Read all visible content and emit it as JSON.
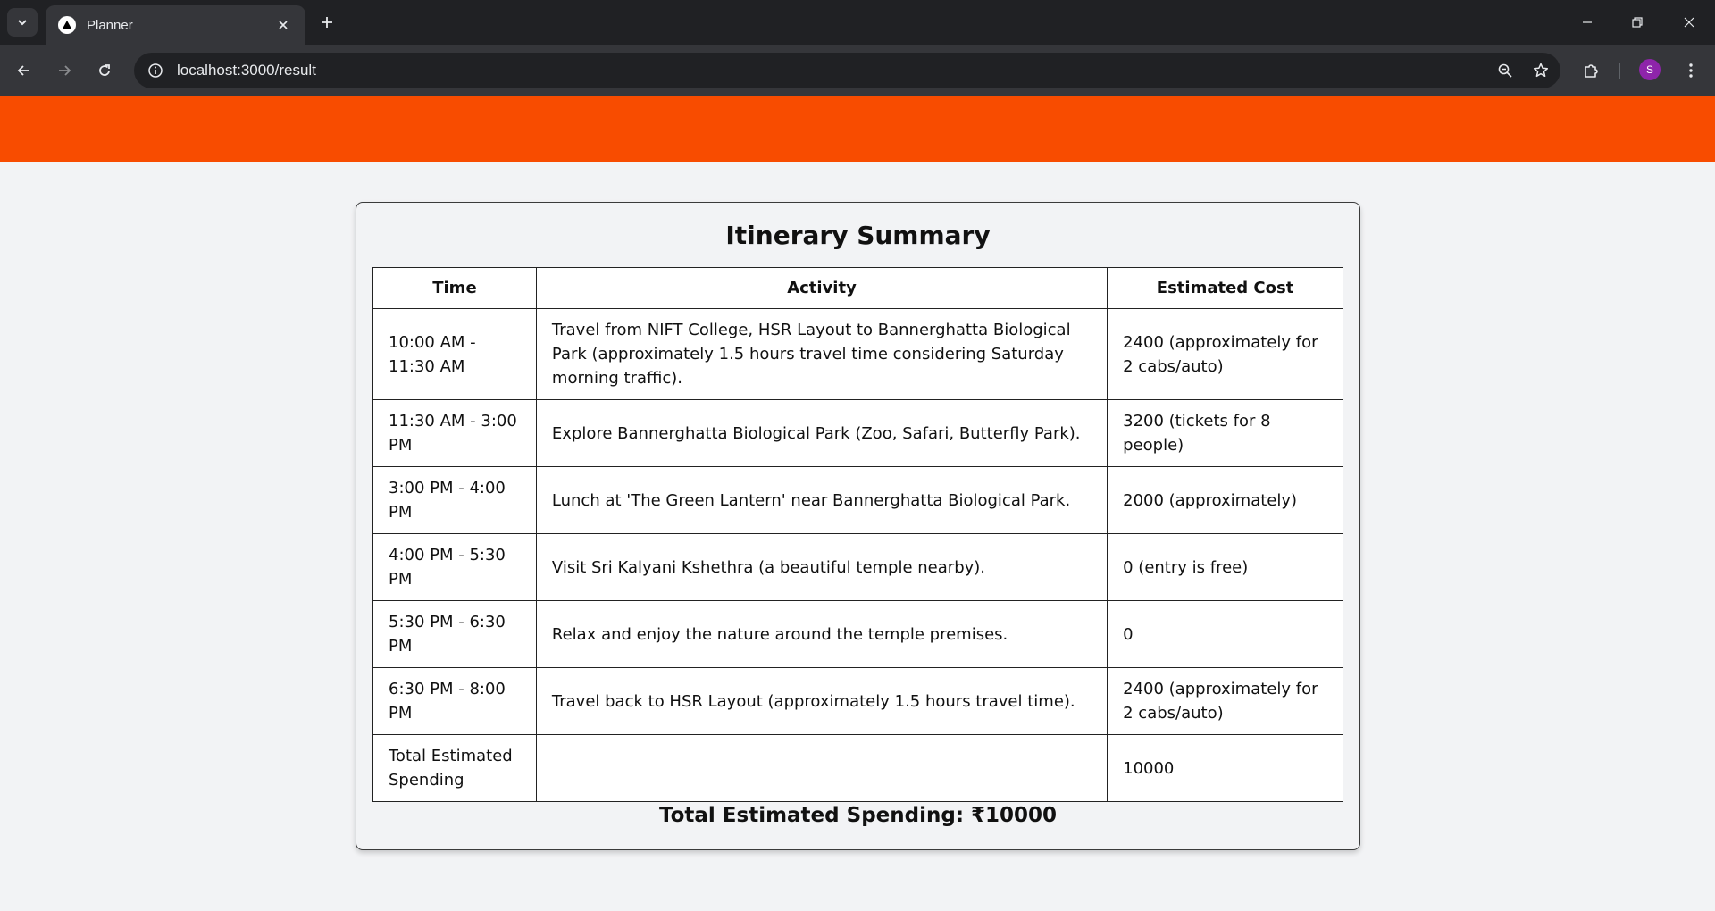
{
  "browser": {
    "tab_title": "Planner",
    "url": "localhost:3000/result",
    "avatar_letter": "S"
  },
  "itinerary": {
    "title": "Itinerary Summary",
    "headers": {
      "time": "Time",
      "activity": "Activity",
      "cost": "Estimated Cost"
    },
    "rows": [
      {
        "time": "10:00 AM - 11:30 AM",
        "activity": "Travel from NIFT College, HSR Layout to Bannerghatta Biological Park (approximately 1.5 hours travel time considering Saturday morning traffic).",
        "cost": "2400 (approximately for 2 cabs/auto)"
      },
      {
        "time": "11:30 AM - 3:00 PM",
        "activity": "Explore Bannerghatta Biological Park (Zoo, Safari, Butterfly Park).",
        "cost": "3200 (tickets for 8 people)"
      },
      {
        "time": "3:00 PM - 4:00 PM",
        "activity": "Lunch at 'The Green Lantern' near Bannerghatta Biological Park.",
        "cost": "2000 (approximately)"
      },
      {
        "time": "4:00 PM - 5:30 PM",
        "activity": "Visit Sri Kalyani Kshethra (a beautiful temple nearby).",
        "cost": "0 (entry is free)"
      },
      {
        "time": "5:30 PM - 6:30 PM",
        "activity": "Relax and enjoy the nature around the temple premises.",
        "cost": "0"
      },
      {
        "time": "6:30 PM - 8:00 PM",
        "activity": "Travel back to HSR Layout (approximately 1.5 hours travel time).",
        "cost": "2400 (approximately for 2 cabs/auto)"
      },
      {
        "time": "Total Estimated Spending",
        "activity": "",
        "cost": "10000"
      }
    ],
    "total_text": "Total Estimated Spending: ₹10000"
  }
}
